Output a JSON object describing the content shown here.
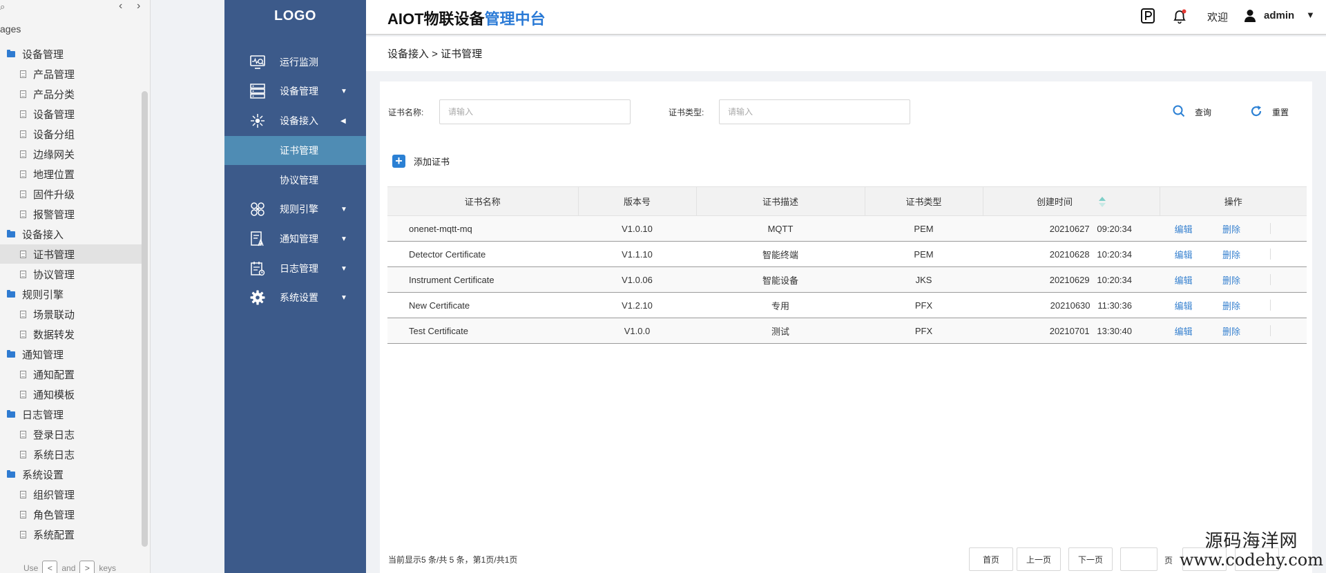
{
  "axure": {
    "search_glyph": "⌕",
    "nav_prev": "‹",
    "nav_next": "›",
    "tree_title": "ages",
    "tree": [
      {
        "type": "folder",
        "label": "设备管理"
      },
      {
        "type": "page",
        "label": "产品管理"
      },
      {
        "type": "page",
        "label": "产品分类"
      },
      {
        "type": "page",
        "label": "设备管理"
      },
      {
        "type": "page",
        "label": "设备分组"
      },
      {
        "type": "page",
        "label": "边缘网关"
      },
      {
        "type": "page",
        "label": "地理位置"
      },
      {
        "type": "page",
        "label": "固件升级"
      },
      {
        "type": "page",
        "label": "报警管理"
      },
      {
        "type": "folder",
        "label": "设备接入"
      },
      {
        "type": "page",
        "label": "证书管理",
        "selected": true
      },
      {
        "type": "page",
        "label": "协议管理"
      },
      {
        "type": "folder",
        "label": "规则引擎"
      },
      {
        "type": "page",
        "label": "场景联动"
      },
      {
        "type": "page",
        "label": "数据转发"
      },
      {
        "type": "folder",
        "label": "通知管理"
      },
      {
        "type": "page",
        "label": "通知配置"
      },
      {
        "type": "page",
        "label": "通知模板"
      },
      {
        "type": "folder",
        "label": "日志管理"
      },
      {
        "type": "page",
        "label": "登录日志"
      },
      {
        "type": "page",
        "label": "系统日志"
      },
      {
        "type": "folder",
        "label": "系统设置"
      },
      {
        "type": "page",
        "label": "组织管理"
      },
      {
        "type": "page",
        "label": "角色管理"
      },
      {
        "type": "page",
        "label": "系统配置"
      }
    ],
    "footer": {
      "use": "Use",
      "key1": "<",
      "and": "and",
      "key2": ">",
      "keys": "keys"
    }
  },
  "nav": {
    "logo": "LOGO",
    "items": [
      {
        "label": "运行监测",
        "icon": "monitor-icon",
        "caret": ""
      },
      {
        "label": "设备管理",
        "icon": "server-icon",
        "caret": "▼"
      },
      {
        "label": "设备接入",
        "icon": "access-hub-icon",
        "caret": "◀"
      },
      {
        "label": "规则引擎",
        "icon": "rule-engine-icon",
        "caret": "▼"
      },
      {
        "label": "通知管理",
        "icon": "notice-icon",
        "caret": "▼"
      },
      {
        "label": "日志管理",
        "icon": "log-icon",
        "caret": "▼"
      },
      {
        "label": "系统设置",
        "icon": "gear-icon",
        "caret": "▼"
      }
    ],
    "subitems": [
      {
        "label": "证书管理",
        "active": true
      },
      {
        "label": "协议管理",
        "active": false
      }
    ]
  },
  "header": {
    "title_part1": "AIOT物联设备",
    "title_part2": "管理中台",
    "welcome": "欢迎",
    "user": "admin",
    "caret": "▼",
    "colors": {
      "accent": "#2a7ad6",
      "nav_bg": "#3c5a8a",
      "nav_active": "#4f8cb4"
    }
  },
  "breadcrumb": "设备接入 > 证书管理",
  "filters": {
    "name_label": "证书名称:",
    "name_placeholder": "请输入",
    "type_label": "证书类型:",
    "type_placeholder": "请输入",
    "search_label": "查询",
    "reset_label": "重置"
  },
  "add_label": "添加证书",
  "table": {
    "columns": [
      "证书名称",
      "版本号",
      "证书描述",
      "证书类型",
      "创建时间",
      "操作"
    ],
    "rows": [
      {
        "name": "onenet-mqtt-mq",
        "version": "V1.0.10",
        "desc": "MQTT",
        "type": "PEM",
        "created": "20210627   09:20:34"
      },
      {
        "name": "Detector  Certificate",
        "version": "V1.1.10",
        "desc": "智能终端",
        "type": "PEM",
        "created": "20210628   10:20:34"
      },
      {
        "name": "Instrument  Certificate",
        "version": "V1.0.06",
        "desc": "智能设备",
        "type": "JKS",
        "created": "20210629   10:20:34"
      },
      {
        "name": "New Certificate",
        "version": "V1.2.10",
        "desc": "专用",
        "type": "PFX",
        "created": "20210630   11:30:36"
      },
      {
        "name": "Test  Certificate",
        "version": "V1.0.0",
        "desc": "测试",
        "type": "PFX",
        "created": "20210701   13:30:40"
      }
    ],
    "edit_label": "编辑",
    "delete_label": "删除"
  },
  "pagination": {
    "info": "当前显示5 条/共 5 条，第1页/共1页",
    "first": "首页",
    "prev": "上一页",
    "next": "下一页",
    "page_suffix": "页"
  },
  "watermark": {
    "line1": "源码海洋网",
    "line2": "www.codehy.com"
  }
}
